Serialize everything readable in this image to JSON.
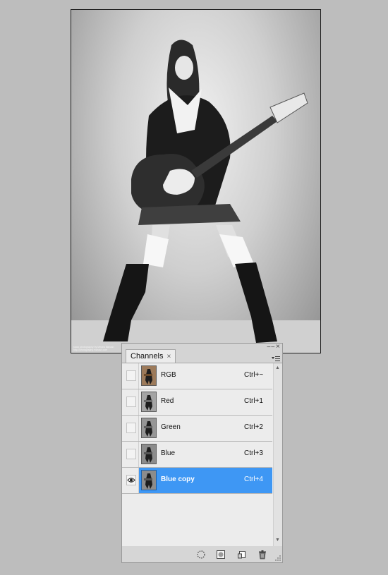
{
  "panel": {
    "tab_label": "Channels",
    "tab_close_glyph": "×",
    "collapse_glyph": "−−",
    "close_glyph": "×",
    "menu_icon": "panel-menu-icon"
  },
  "canvas": {
    "credit_line1": "stock photography by Mircea Marush",
    "credit_line2": "http://photography.marush.com"
  },
  "channels": [
    {
      "name": "RGB",
      "shortcut": "Ctrl+~",
      "visible": false,
      "selected": false,
      "thumb": "color"
    },
    {
      "name": "Red",
      "shortcut": "Ctrl+1",
      "visible": false,
      "selected": false,
      "thumb": "gray"
    },
    {
      "name": "Green",
      "shortcut": "Ctrl+2",
      "visible": false,
      "selected": false,
      "thumb": "gray"
    },
    {
      "name": "Blue",
      "shortcut": "Ctrl+3",
      "visible": false,
      "selected": false,
      "thumb": "gray"
    },
    {
      "name": "Blue copy",
      "shortcut": "Ctrl+4",
      "visible": true,
      "selected": true,
      "thumb": "gray"
    }
  ],
  "footer_icons": [
    "load-selection-icon",
    "save-selection-icon",
    "new-channel-icon",
    "delete-channel-icon"
  ],
  "colors": {
    "selection": "#3e97f4",
    "background": "#bdbdbd"
  }
}
